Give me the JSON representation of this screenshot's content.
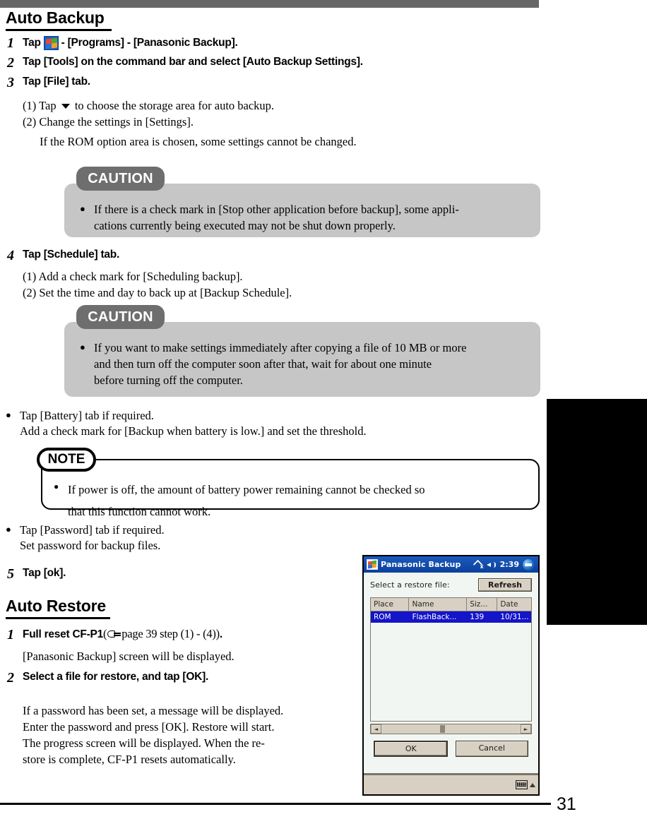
{
  "page": {
    "number": "31"
  },
  "sections": [
    {
      "heading": "Auto Backup",
      "steps": [
        {
          "num": "1",
          "pre": "Tap ",
          "icon": "windows-start-icon",
          "post": " - [Programs] - [Panasonic Backup]."
        },
        {
          "num": "2",
          "text": "Tap [Tools] on the command bar and select [Auto Backup Settings]."
        },
        {
          "num": "3",
          "text": "Tap [File] tab."
        },
        {
          "num": "4",
          "text": "Tap [Schedule] tab."
        },
        {
          "num": "5",
          "text": "Tap [ok]."
        }
      ]
    },
    {
      "heading": "Auto Restore"
    }
  ],
  "step3_substeps": {
    "line1_pre": "(1) Tap ",
    "line1_icon": "dropdown-arrow-icon",
    "line1_post": " to choose the storage area for auto backup.",
    "line2": "(2) Change the settings in [Settings].",
    "line3": "If the ROM option area is chosen, some settings cannot be changed."
  },
  "caution1": {
    "tag": "CAUTION",
    "bullet": "●",
    "lines": [
      "If there is a check mark in [Stop other application before backup], some appli-",
      "cations currently being executed may not be shut down properly."
    ]
  },
  "step4_substeps": {
    "line1": "(1) Add a check mark for [Scheduling backup].",
    "line2": "(2) Set the time and day to back up at [Backup Schedule]."
  },
  "caution2": {
    "tag": "CAUTION",
    "bullet": "●",
    "lines": [
      "If you want to make settings immediately after copying a file of 10 MB or more",
      "and then turn off the computer soon after that, wait for about one minute",
      "before turning off the computer."
    ]
  },
  "battery_item": {
    "bullet": "●",
    "lines": [
      "Tap [Battery] tab if required.",
      "Add a check mark for [Backup when battery is low.] and set the threshold."
    ]
  },
  "note": {
    "tag": "NOTE",
    "bullet": "●",
    "lines": [
      "If power is off, the amount of battery power remaining cannot be checked so",
      "that this function cannot work."
    ]
  },
  "password_item": {
    "bullet": "●",
    "lines": [
      "Tap [Password] tab if required.",
      "Set password for backup files."
    ]
  },
  "restore_steps": {
    "step1": {
      "num": "1",
      "bold_pre": "Full reset CF-P1",
      "ref_open": "(",
      "ref_icon": "pointing-hand-icon",
      "ref_text": " page 39 step (1) - (4)",
      "ref_close": ")",
      "bold_post": ".",
      "follow": "[Panasonic Backup] screen will be displayed."
    },
    "step2": {
      "num": "2",
      "text": "Select a file for restore, and tap [OK].",
      "body": [
        "If a password has been set, a message will be displayed.",
        "Enter the password and press [OK]. Restore will start.",
        "The progress screen will be displayed. When the re-",
        "store is complete, CF-P1 resets automatically."
      ]
    }
  },
  "pda": {
    "titlebar": {
      "app_icon": "windows-start-icon",
      "title": "Panasonic Backup",
      "network_icon": "network-disconnected-icon",
      "network_badge": "x",
      "speaker_icon": "speaker-icon",
      "clock": "2:39",
      "orb_icon": "status-orb-icon"
    },
    "prompt": "Select a restore file:",
    "refresh_button": "Refresh",
    "table": {
      "headers": [
        "Place",
        "Name",
        "Siz...",
        "Date"
      ],
      "rows": [
        [
          "ROM",
          "FlashBack...",
          "139",
          "10/31..."
        ]
      ]
    },
    "scrollbar": {
      "left_arrow": "◄",
      "right_arrow": "►"
    },
    "buttons": {
      "ok": "OK",
      "cancel": "Cancel"
    },
    "commandbar": {
      "sip_icon": "soft-input-panel-icon",
      "sip_chevron": "chevron-up-icon"
    }
  }
}
